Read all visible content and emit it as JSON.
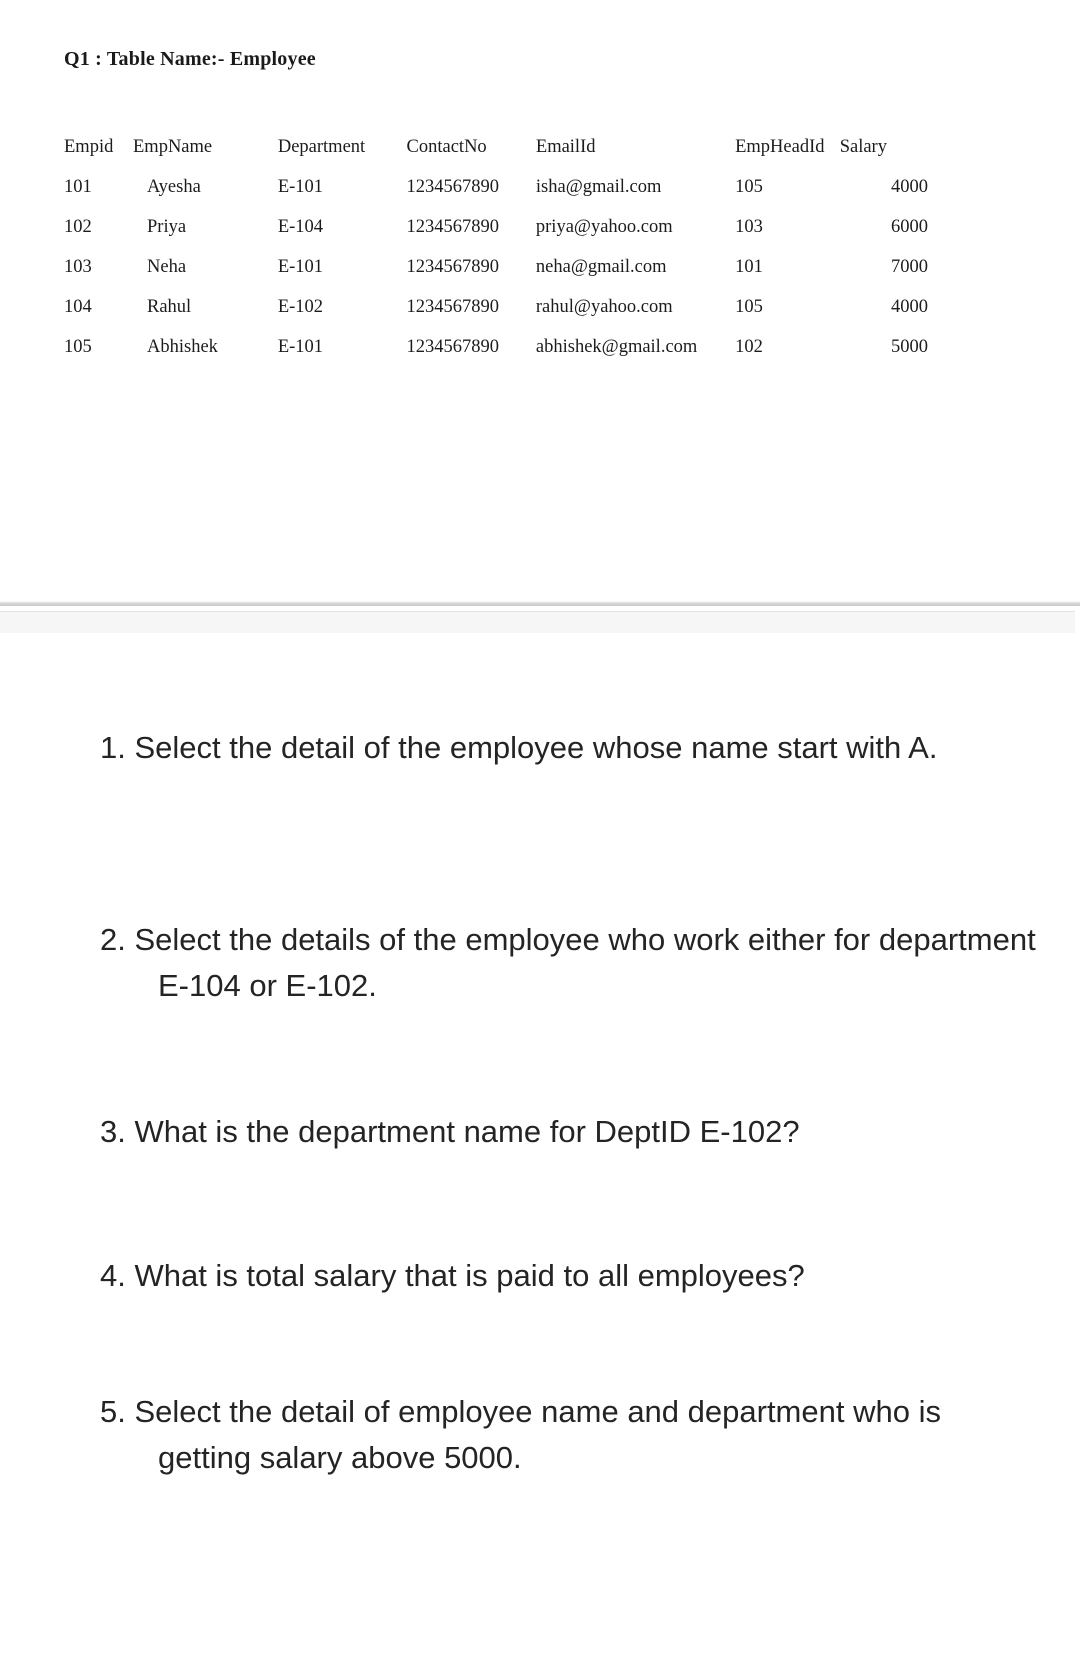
{
  "document": {
    "title": "Q1 : Table Name:- Employee"
  },
  "table": {
    "name": "Employee",
    "columns": [
      "Empid",
      "EmpName",
      "Department",
      "ContactNo",
      "EmailId",
      "EmpHeadId",
      "Salary"
    ],
    "rows": [
      {
        "empid": "101",
        "empname": "Ayesha",
        "department": "E-101",
        "contactno": "1234567890",
        "emailid": "isha@gmail.com",
        "empheadid": "105",
        "salary": "4000"
      },
      {
        "empid": "102",
        "empname": "Priya",
        "department": "E-104",
        "contactno": "1234567890",
        "emailid": "priya@yahoo.com",
        "empheadid": "103",
        "salary": "6000"
      },
      {
        "empid": "103",
        "empname": "Neha",
        "department": "E-101",
        "contactno": "1234567890",
        "emailid": "neha@gmail.com",
        "empheadid": "101",
        "salary": "7000"
      },
      {
        "empid": "104",
        "empname": "Rahul",
        "department": "E-102",
        "contactno": "1234567890",
        "emailid": "rahul@yahoo.com",
        "empheadid": "105",
        "salary": "4000"
      },
      {
        "empid": "105",
        "empname": "Abhishek",
        "department": "E-101",
        "contactno": "1234567890",
        "emailid": "abhishek@gmail.com",
        "empheadid": "102",
        "salary": "5000"
      }
    ]
  },
  "questions": [
    {
      "number": "1.",
      "text": "Select the detail of the employee whose name start with A."
    },
    {
      "number": "2.",
      "text": "Select the details of the employee who work either for department E-104 or E-102."
    },
    {
      "number": "3.",
      "text": "What is the department name for DeptID E-102?"
    },
    {
      "number": "4.",
      "text": "What is total salary that is paid to all employees?"
    },
    {
      "number": "5.",
      "text": "Select the detail of employee name and department who is getting salary above 5000."
    }
  ]
}
